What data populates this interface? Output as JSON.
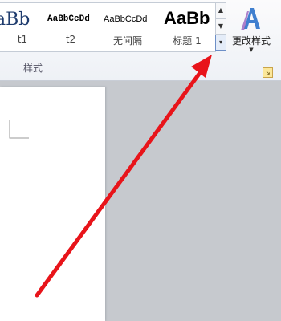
{
  "ribbon": {
    "styles_group_label": "样式",
    "styles": [
      {
        "sample": "aBb",
        "label": "t1"
      },
      {
        "sample": "AaBbCcDd",
        "label": "t2"
      },
      {
        "sample": "AaBbCcDd",
        "label": "无间隔"
      },
      {
        "sample": "AaBb",
        "label": "标题 1"
      }
    ],
    "change_styles_label": "更改样式"
  },
  "colors": {
    "annotation_arrow": "#e8141a",
    "workspace": "#c6c9ce"
  }
}
